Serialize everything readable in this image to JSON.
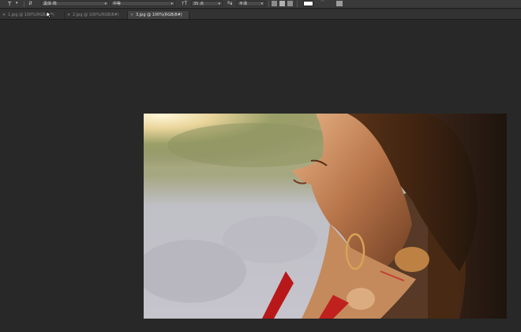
{
  "options_bar": {
    "font_family": "黑体-简",
    "font_style": "中等",
    "font_size": "35 点",
    "anti_alias": "平滑",
    "text_color": "#ffffff"
  },
  "tabs": [
    {
      "label": "1.jpg @ 100%(RGB/8#)",
      "active": false
    },
    {
      "label": "2.jpg @ 100%(RGB/8#)",
      "active": false
    },
    {
      "label": "3.jpg @ 100%(RGB/8#)",
      "active": true
    }
  ],
  "colors": {
    "workspace_bg": "#282828",
    "panel_bg": "#3a3a3a",
    "active_tab_bg": "#424242"
  }
}
